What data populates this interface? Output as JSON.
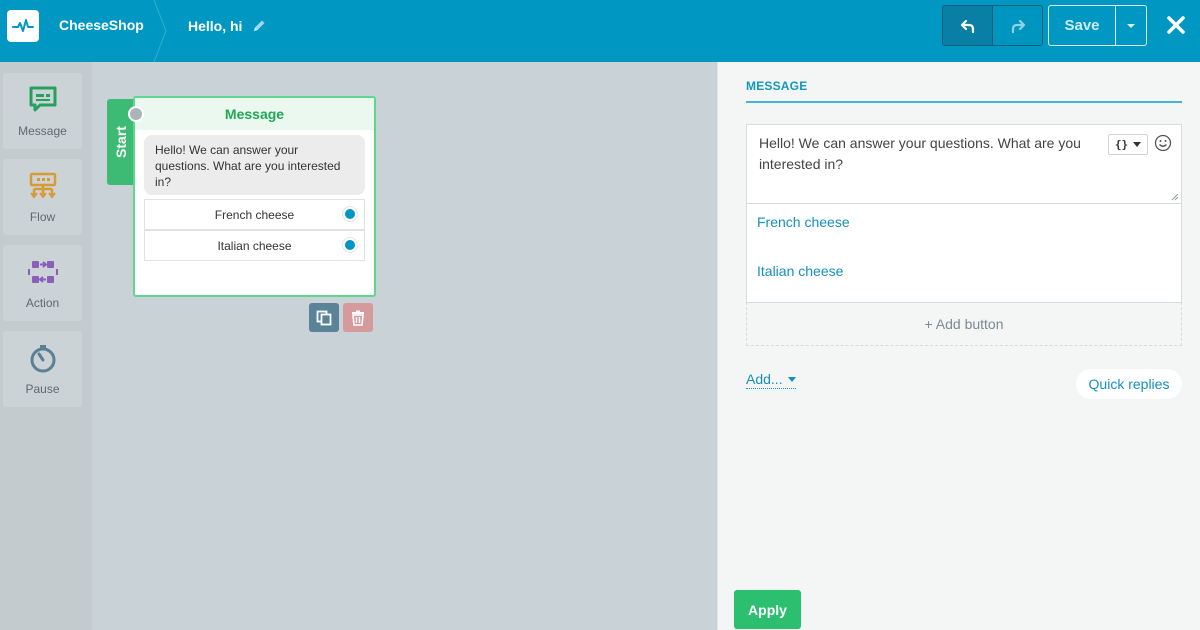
{
  "header": {
    "app_name": "CheeseShop",
    "flow_name": "Hello, hi",
    "save_label": "Save"
  },
  "sidebar": {
    "tools": [
      {
        "label": "Message",
        "icon": "message-icon"
      },
      {
        "label": "Flow",
        "icon": "flow-icon"
      },
      {
        "label": "Action",
        "icon": "action-icon"
      },
      {
        "label": "Pause",
        "icon": "pause-timer-icon"
      }
    ]
  },
  "canvas": {
    "start_label": "Start",
    "node": {
      "title": "Message",
      "text": "Hello! We can answer your questions. What are you interested in?",
      "buttons": [
        "French cheese",
        "Italian cheese"
      ]
    }
  },
  "panel": {
    "title": "MESSAGE",
    "message_text": "Hello! We can answer your questions. What are you interested in?",
    "variable_button": "{}",
    "buttons": [
      "French cheese",
      "Italian cheese"
    ],
    "add_button_label": "+ Add button",
    "add_dropdown_label": "Add...",
    "quick_replies_label": "Quick replies",
    "apply_label": "Apply"
  },
  "colors": {
    "header": "#0098c2",
    "node_accent": "#5fd58f",
    "start_tab": "#3dbb74",
    "link": "#1690bd",
    "apply": "#2bbf6f"
  }
}
